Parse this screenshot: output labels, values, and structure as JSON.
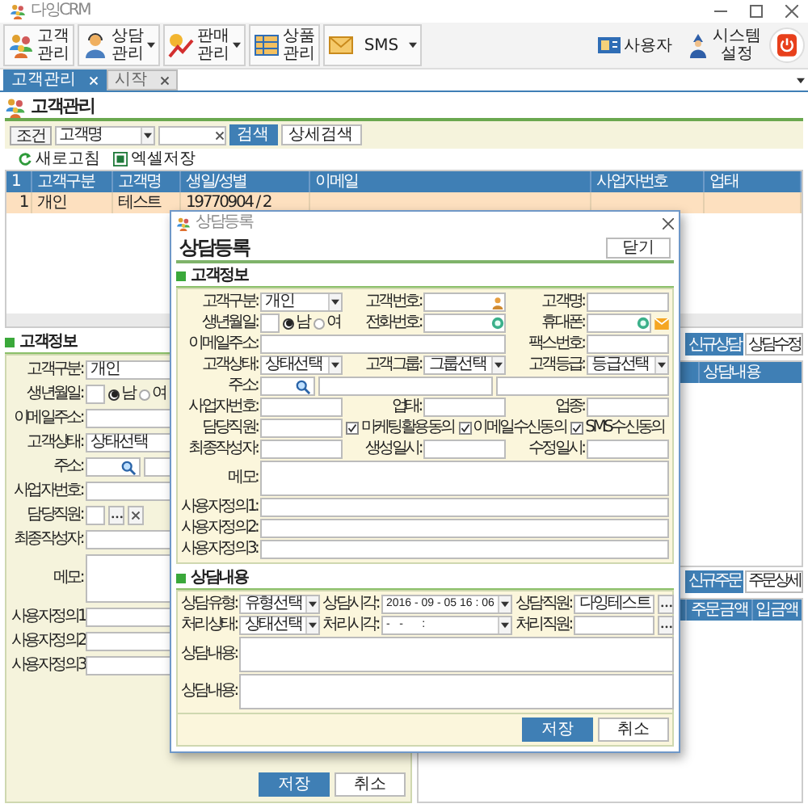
{
  "window": {
    "title": "다잉CRM"
  },
  "toolbar": {
    "items": [
      {
        "label": "고객관리",
        "dropdown": false
      },
      {
        "label": "상담관리",
        "dropdown": true
      },
      {
        "label": "판매관리",
        "dropdown": true
      },
      {
        "label": "상품관리",
        "dropdown": false
      },
      {
        "label": "SMS",
        "dropdown": true
      }
    ],
    "right_items": [
      {
        "label": "사용자"
      },
      {
        "label": "시스템설정"
      }
    ]
  },
  "tabs": [
    {
      "label": "고객관리",
      "selected": true
    },
    {
      "label": "시작",
      "selected": false
    }
  ],
  "page": {
    "title": "고객관리"
  },
  "search": {
    "label": "조건",
    "field": "고객명",
    "buttons": [
      {
        "label": "검색",
        "kind": "primary"
      },
      {
        "label": "상세검색",
        "kind": "secondary"
      }
    ]
  },
  "actions": [
    {
      "label": "새로고침"
    },
    {
      "label": "엑셀저장"
    }
  ],
  "table": {
    "columns": [
      "1",
      "고객구분",
      "고객명",
      "생일/성별",
      "이메일",
      "사업자번호",
      "업태"
    ],
    "rows": [
      {
        "cells": [
          "1",
          "개인",
          "테스트",
          "19770904 / 2"
        ],
        "selected": true
      }
    ]
  },
  "customer_panel": {
    "title": "고객정보",
    "fields": [
      {
        "label": "고객구분:",
        "kind": "select",
        "value": "개인"
      },
      {
        "label": "생년월일:",
        "kind": "birth",
        "options": [
          {
            "label": "남",
            "selected": true
          },
          {
            "label": "여",
            "selected": false
          }
        ]
      },
      {
        "label": "이메일주소:",
        "kind": "wide"
      },
      {
        "label": "고객상태:",
        "kind": "select",
        "value": "상태선택"
      },
      {
        "label": "주소:",
        "kind": "address"
      },
      {
        "label": "사업자번호:",
        "kind": "text"
      },
      {
        "label": "담당직원:",
        "kind": "staff"
      },
      {
        "label": "최종작성자:",
        "kind": "text"
      },
      {
        "label": "메모:",
        "kind": "memo"
      },
      {
        "label": "사용자정의1:",
        "kind": "wide"
      },
      {
        "label": "사용자정의2:",
        "kind": "wide"
      },
      {
        "label": "사용자정의3:",
        "kind": "wide"
      }
    ],
    "buttons": [
      {
        "label": "저장",
        "kind": "primary"
      },
      {
        "label": "취소",
        "kind": "secondary"
      }
    ]
  },
  "consult_list": {
    "buttons": [
      {
        "label": "신규상담",
        "kind": "primary"
      },
      {
        "label": "상담수정",
        "kind": "secondary"
      }
    ],
    "columns": [
      "상담내용"
    ]
  },
  "order_list": {
    "buttons": [
      {
        "label": "신규주문",
        "kind": "primary"
      },
      {
        "label": "주문상세",
        "kind": "secondary"
      }
    ],
    "columns": [
      "주문금액",
      "입금액"
    ]
  },
  "dialog": {
    "title": "상담등록",
    "heading": "상담등록",
    "close_button": "닫기",
    "customer_section": {
      "title": "고객정보",
      "fields": [
        {
          "label": "고객구분:",
          "kind": "select",
          "value": "개인"
        },
        {
          "label": "고객번호:",
          "kind": "customer_no"
        },
        {
          "label": "고객명:",
          "kind": "text"
        },
        {
          "label": "생년월일:",
          "kind": "birth",
          "options": [
            {
              "label": "남",
              "selected": true
            },
            {
              "label": "여",
              "selected": false
            }
          ]
        },
        {
          "label": "전화번호:",
          "kind": "phone"
        },
        {
          "label": "휴대폰:",
          "kind": "mobile"
        },
        {
          "label": "이메일주소:",
          "kind": "email"
        },
        {
          "label": "팩스번호:",
          "kind": "text"
        },
        {
          "label": "고객상태:",
          "kind": "select",
          "value": "상태선택"
        },
        {
          "label": "고객그룹:",
          "kind": "select",
          "value": "그룹선택"
        },
        {
          "label": "고객등급:",
          "kind": "select",
          "value": "등급선택"
        },
        {
          "label": "주소:",
          "kind": "address"
        },
        {
          "label": "사업자번호:",
          "kind": "text"
        },
        {
          "label": "업태:",
          "kind": "text"
        },
        {
          "label": "업종:",
          "kind": "text"
        },
        {
          "label": "담당직원:",
          "kind": "text"
        },
        {
          "kind": "consents",
          "options": [
            {
              "label": "마케팅활용동의",
              "checked": true
            },
            {
              "label": "이메일수신동의",
              "checked": true
            },
            {
              "label": "SMS수신동의",
              "checked": true
            }
          ]
        },
        {
          "label": "최종작성자:",
          "kind": "text"
        },
        {
          "label": "생성일시:",
          "kind": "text"
        },
        {
          "label": "수정일시:",
          "kind": "text"
        },
        {
          "label": "메모:",
          "kind": "memo"
        },
        {
          "label": "사용자정의1:",
          "kind": "wide"
        },
        {
          "label": "사용자정의2:",
          "kind": "wide"
        },
        {
          "label": "사용자정의3:",
          "kind": "wide"
        }
      ]
    },
    "consult_section": {
      "title": "상담내용",
      "fields": [
        {
          "label": "상담유형:",
          "kind": "select",
          "value": "유형선택"
        },
        {
          "label": "상담시각:",
          "kind": "datetime",
          "value": "2016 - 09 - 05 16 : 06"
        },
        {
          "label": "상담직원:",
          "kind": "picker",
          "value": "다잉테스트"
        },
        {
          "label": "처리상태:",
          "kind": "select",
          "value": "상태선택"
        },
        {
          "label": "처리시각:",
          "kind": "datetime",
          "value": "-   -      :"
        },
        {
          "label": "처리직원:",
          "kind": "picker"
        },
        {
          "label": "상담내용:",
          "kind": "memo"
        },
        {
          "label": "상담내용:",
          "kind": "memo"
        }
      ],
      "buttons": [
        {
          "label": "저장",
          "kind": "primary"
        },
        {
          "label": "취소",
          "kind": "secondary"
        }
      ]
    }
  }
}
